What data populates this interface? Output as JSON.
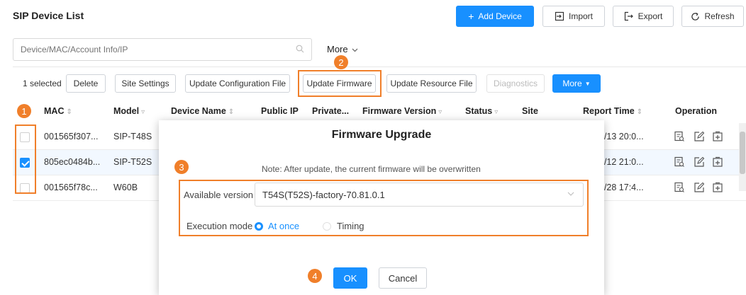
{
  "header": {
    "title": "SIP Device List",
    "add_label": "Add Device",
    "import_label": "Import",
    "export_label": "Export",
    "refresh_label": "Refresh"
  },
  "search": {
    "placeholder": "Device/MAC/Account Info/IP",
    "more_label": "More"
  },
  "toolbar": {
    "selected_text": "1 selected",
    "delete_label": "Delete",
    "site_settings_label": "Site Settings",
    "update_config_label": "Update Configuration File",
    "update_firmware_label": "Update Firmware",
    "update_resource_label": "Update Resource File",
    "diagnostics_label": "Diagnostics",
    "more_label": "More"
  },
  "table": {
    "columns": [
      "MAC",
      "Model",
      "Device Name",
      "Public IP",
      "Private...",
      "Firmware Version",
      "Status",
      "Site",
      "Report Time",
      "Operation"
    ],
    "rows": [
      {
        "mac": "001565f307...",
        "model": "SIP-T48S",
        "report_time": "2/13 20:0...",
        "checked": false
      },
      {
        "mac": "805ec0484b...",
        "model": "SIP-T52S",
        "report_time": "2/12 21:0...",
        "checked": true
      },
      {
        "mac": "001565f78c...",
        "model": "W60B",
        "report_time": "1/28 17:4...",
        "checked": false
      }
    ]
  },
  "dialog": {
    "title": "Firmware Upgrade",
    "note": "Note: After update, the current firmware will be overwritten",
    "available_version_label": "Available version",
    "available_version_value": "T54S(T52S)-factory-70.81.0.1",
    "execution_mode_label": "Execution mode",
    "mode_options": [
      "At once",
      "Timing"
    ],
    "mode_selected": "At once",
    "ok_label": "OK",
    "cancel_label": "Cancel"
  },
  "steps": [
    "1",
    "2",
    "3",
    "4"
  ],
  "colors": {
    "primary": "#1890ff",
    "highlight": "#f07f2a"
  }
}
